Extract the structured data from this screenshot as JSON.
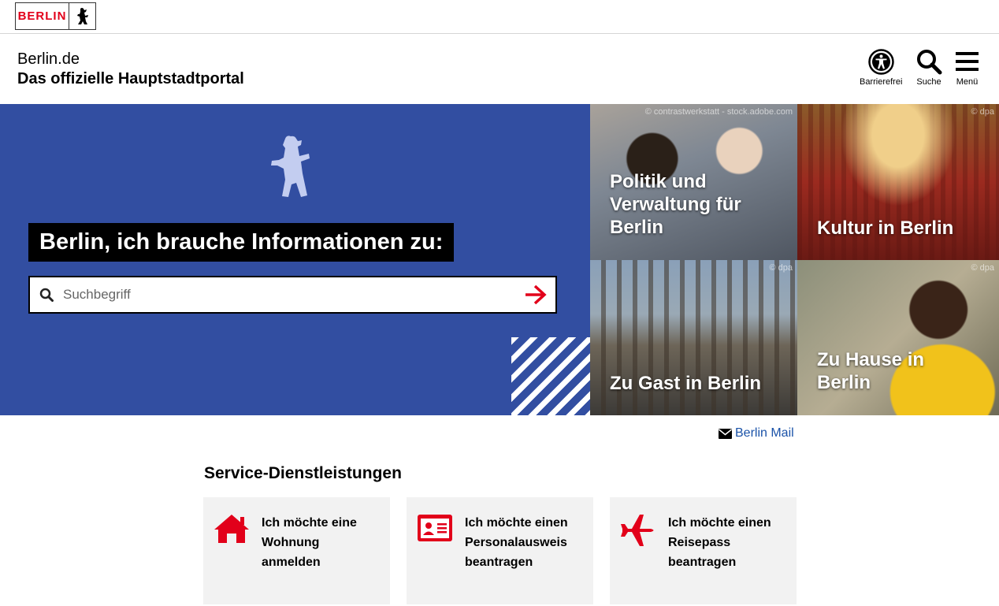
{
  "logo": {
    "text": "BERLIN"
  },
  "header": {
    "site_name": "Berlin.de",
    "site_subtitle": "Das offizielle Hauptstadtportal",
    "icons": {
      "accessibility": "Barrierefrei",
      "search": "Suche",
      "menu": "Menü"
    }
  },
  "hero": {
    "title": "Berlin, ich brauche Informationen zu:",
    "search": {
      "placeholder": "Suchbegriff",
      "value": ""
    }
  },
  "tiles": [
    {
      "title": "Politik und Verwaltung für Berlin",
      "credit": "© contrastwerkstatt - stock.adobe.com"
    },
    {
      "title": "Kultur in Berlin",
      "credit": "© dpa"
    },
    {
      "title": "Zu Gast in Berlin",
      "credit": "© dpa"
    },
    {
      "title": "Zu Hause in Berlin",
      "credit": "© dpa"
    }
  ],
  "mail": {
    "label": "Berlin Mail"
  },
  "services": {
    "heading": "Service-Dienstleistungen",
    "cards": [
      {
        "text": "Ich möchte eine Wohnung anmelden",
        "icon": "house-icon"
      },
      {
        "text": "Ich möchte einen Personalausweis beantragen",
        "icon": "id-card-icon"
      },
      {
        "text": "Ich möchte einen Reisepass beantragen",
        "icon": "airplane-icon"
      }
    ]
  },
  "colors": {
    "brand_red": "#e2001a",
    "hero_blue": "#324ea1",
    "link_blue": "#1a52a8"
  }
}
